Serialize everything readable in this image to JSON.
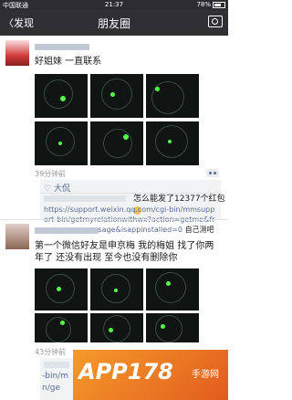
{
  "status": {
    "carrier": "中国联通",
    "network": "中国联通",
    "time": "21:37",
    "battery": "78%"
  },
  "nav": {
    "back": "〈发现",
    "title": "朋友圈"
  },
  "post1": {
    "text": "好姐妹 一直联系",
    "time": "39分钟前",
    "like_name": "大侃",
    "comment_text": "怎么能发了12377个红包",
    "link": "https://support.weixin.qq.com/cgi-bin/mmsupport-bin/getmyrelationwithwx?action=getme&from=groupmessage&isappinstalled=0",
    "link_suffix": "自己测吧"
  },
  "post2": {
    "text": "第一个微信好友是申京梅 我的梅姐 找了你两年了 还没有出现 至今也没有删除你",
    "time": "43分钟前",
    "partial": "-bin/m",
    "partial2": "n/ge"
  },
  "watermark": {
    "main": "APP178",
    "sub": "手游网"
  }
}
